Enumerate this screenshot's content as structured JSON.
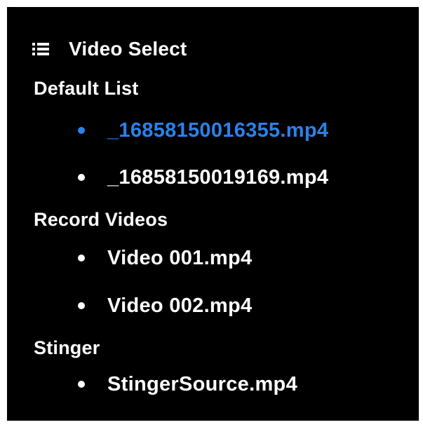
{
  "header": {
    "title": "Video Select",
    "icon": "list-icon"
  },
  "colors": {
    "panel_background": "#000000",
    "text": "#ffffff",
    "selected": "#2b82ea"
  },
  "sections": [
    {
      "title": "Default List",
      "items": [
        {
          "label": "_16858150016355.mp4",
          "selected": true
        },
        {
          "label": "_16858150019169.mp4",
          "selected": false
        }
      ]
    },
    {
      "title": "Record Videos",
      "items": [
        {
          "label": "Video 001.mp4",
          "selected": false
        },
        {
          "label": "Video 002.mp4",
          "selected": false
        }
      ]
    },
    {
      "title": "Stinger",
      "items": [
        {
          "label": "StingerSource.mp4",
          "selected": false
        }
      ]
    }
  ]
}
